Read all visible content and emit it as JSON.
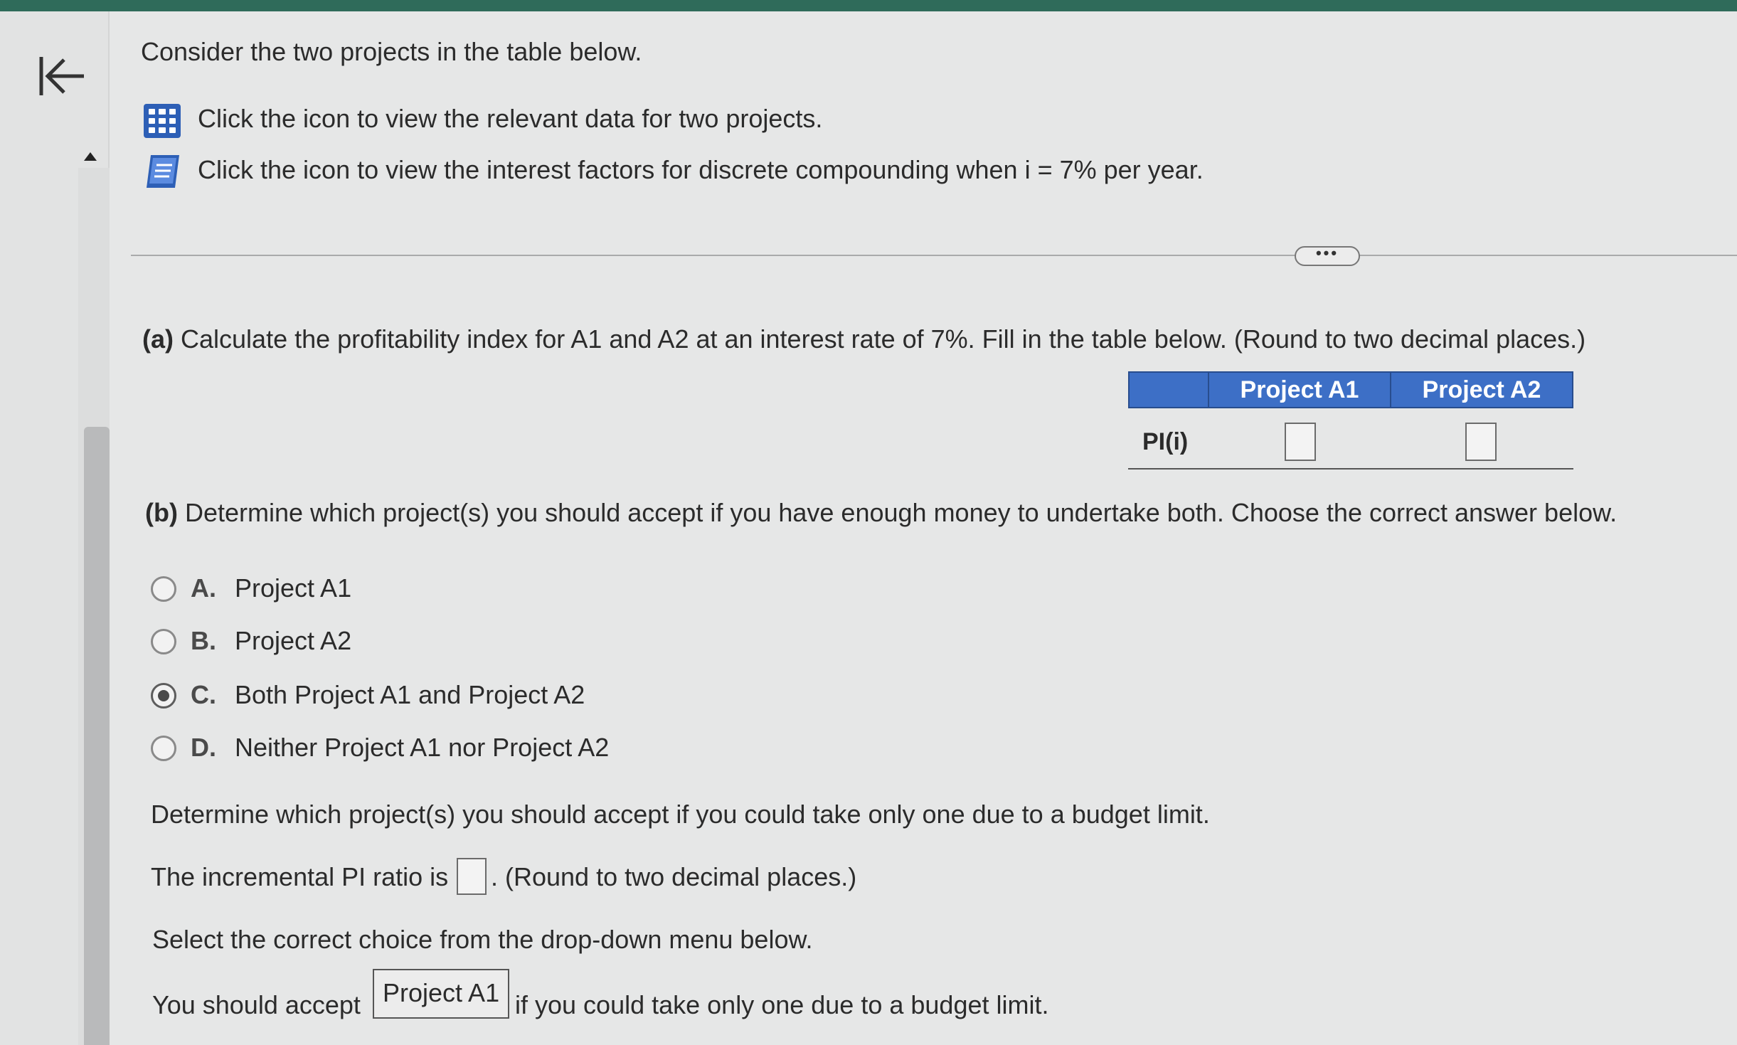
{
  "intro": "Consider the two projects in the table below.",
  "links": [
    {
      "icon": "grid-table-icon",
      "text": "Click the icon to view the relevant data for two projects."
    },
    {
      "icon": "book-icon",
      "text": "Click the icon to view the interest factors for discrete compounding when i = 7% per year."
    }
  ],
  "ellipsis": "•••",
  "part_a": {
    "label": "(a)",
    "text": "Calculate the profitability index for A1 and A2 at an interest rate of 7%. Fill in the table below. (Round to two decimal places.)",
    "table": {
      "columns": [
        "Project A1",
        "Project A2"
      ],
      "row_label": "PI(i)",
      "values": [
        "",
        ""
      ]
    }
  },
  "part_b": {
    "label": "(b)",
    "text": "Determine which project(s) you should accept if you have enough money to undertake both. Choose the correct answer below.",
    "options": [
      {
        "letter": "A.",
        "text": "Project A1",
        "selected": false
      },
      {
        "letter": "B.",
        "text": "Project A2",
        "selected": false
      },
      {
        "letter": "C.",
        "text": "Both Project A1 and Project A2",
        "selected": true
      },
      {
        "letter": "D.",
        "text": "Neither Project A1 nor Project A2",
        "selected": false
      }
    ]
  },
  "budget": {
    "question": "Determine which project(s) you should accept if you could take only one due to a budget limit.",
    "incremental_prefix": "The incremental PI ratio is",
    "incremental_value": "",
    "incremental_suffix": ". (Round to two decimal places.)",
    "select_note": "Select the correct choice from the drop-down menu below.",
    "accept_prefix": "You should accept",
    "accept_selected": "Project A1",
    "accept_suffix": "if you could take only one due to a budget limit."
  },
  "colors": {
    "table_header": "#3d6fc6",
    "topbar": "#2f6b5a",
    "icon_blue": "#2d5fb6"
  }
}
